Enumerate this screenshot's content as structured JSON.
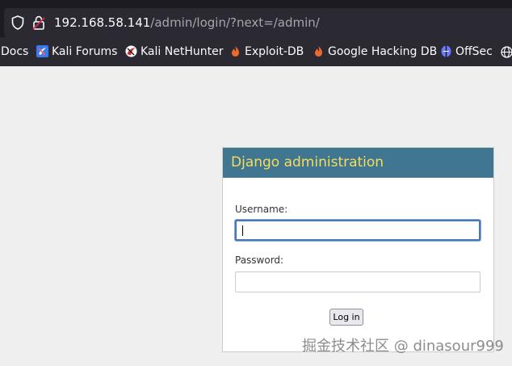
{
  "browser": {
    "url_host": "192.168.58.141",
    "url_path": "/admin/login/?next=/admin/",
    "bookmarks": [
      {
        "label": "Docs",
        "icon": "none"
      },
      {
        "label": "Kali Forums",
        "icon": "kali-forums-icon"
      },
      {
        "label": "Kali NetHunter",
        "icon": "kali-nethunter-icon"
      },
      {
        "label": "Exploit-DB",
        "icon": "exploit-db-icon"
      },
      {
        "label": "Google Hacking DB",
        "icon": "ghdb-icon"
      },
      {
        "label": "OffSec",
        "icon": "offsec-icon"
      }
    ]
  },
  "login": {
    "title": "Django administration",
    "username_label": "Username:",
    "username_value": "",
    "password_label": "Password:",
    "password_value": "",
    "submit_label": "Log in"
  },
  "watermark": "掘金技术社区 @ dinasour999",
  "colors": {
    "header_bg": "#417690",
    "header_text": "#f5dd5d",
    "page_bg": "#efefef",
    "chrome_bg": "#1c1b22",
    "bookmarks_bg": "#2b2a33"
  }
}
